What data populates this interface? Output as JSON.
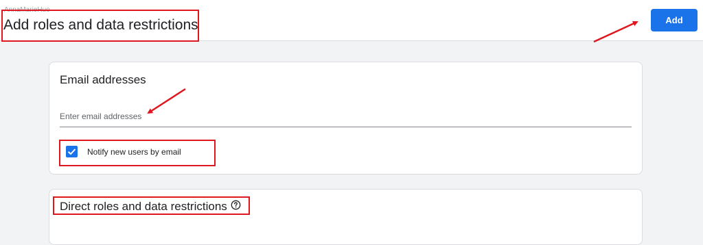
{
  "header": {
    "breadcrumb": "AnnaMarieHuo",
    "title": "Add roles and data restrictions",
    "add_button_label": "Add"
  },
  "email_card": {
    "title": "Email addresses",
    "email_input": {
      "value": "",
      "placeholder": "Enter email addresses"
    },
    "notify_checkbox": {
      "label": "Notify new users by email",
      "checked": true
    }
  },
  "roles_card": {
    "title": "Direct roles and data restrictions",
    "help_icon": "help-circle-icon"
  },
  "colors": {
    "accent": "#1a73e8",
    "annotation": "#e0161e",
    "page_background": "#f1f3f4"
  }
}
